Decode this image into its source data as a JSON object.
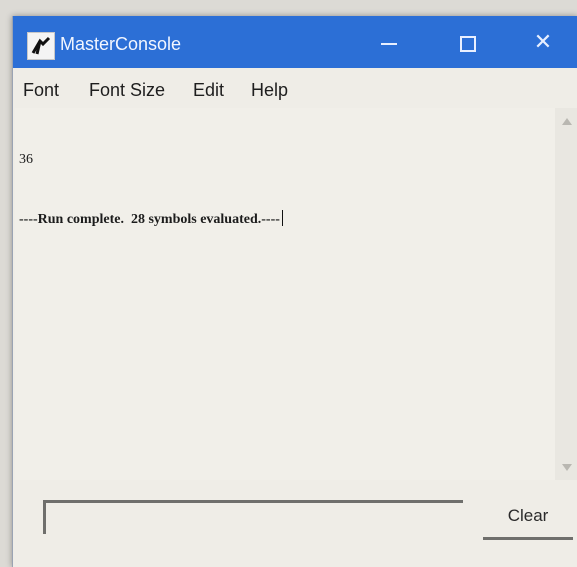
{
  "window": {
    "title": "MasterConsole",
    "controls": {
      "minimize": "minimize",
      "maximize": "maximize",
      "close": "✕"
    }
  },
  "menubar": {
    "items": [
      "Font",
      "Font Size",
      "Edit",
      "Help"
    ]
  },
  "console": {
    "lines": [
      "36",
      "----Run complete.  28 symbols evaluated.----"
    ]
  },
  "input": {
    "value": "",
    "placeholder": ""
  },
  "buttons": {
    "clear": "Clear"
  },
  "colors": {
    "titlebar": "#2c6fd6",
    "window_bg": "#efede7",
    "text": "#1c1c1c"
  }
}
